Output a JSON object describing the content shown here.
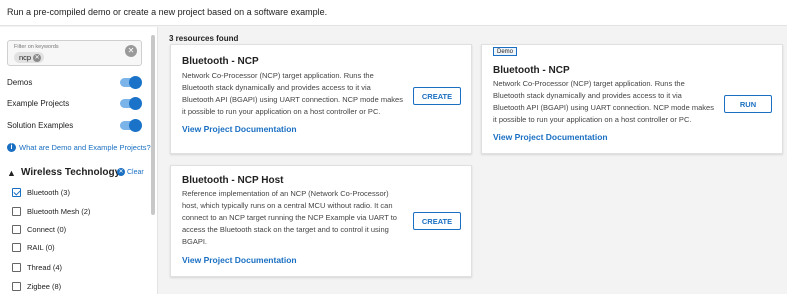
{
  "header": {
    "text": "Run a pre-compiled demo or create a new project based on a software example."
  },
  "sidebar": {
    "filter": {
      "label": "Filter on keywords",
      "chip": "ncp",
      "chip_remove": "✕",
      "clear_icon": "✕"
    },
    "toggles": [
      {
        "label": "Demos",
        "on": true
      },
      {
        "label": "Example Projects",
        "on": true
      },
      {
        "label": "Solution Examples",
        "on": true
      }
    ],
    "info_link": {
      "icon": "i",
      "text": "What are Demo and Example Projects?"
    },
    "wireless": {
      "chevron": "▲",
      "title": "Wireless Technology",
      "clear_icon": "✕",
      "clear_label": "Clear",
      "items": [
        {
          "label": "Bluetooth (3)",
          "checked": true
        },
        {
          "label": "Bluetooth Mesh (2)",
          "checked": false
        },
        {
          "label": "Connect (0)",
          "checked": false
        },
        {
          "label": "RAIL (0)",
          "checked": false
        },
        {
          "label": "Thread (4)",
          "checked": false
        },
        {
          "label": "Zigbee (8)",
          "checked": false
        }
      ]
    }
  },
  "main": {
    "results": "3 resources found",
    "cards": [
      {
        "title": "Bluetooth - NCP",
        "desc": [
          "Network Co-Processor (NCP) target application. Runs the",
          "Bluetooth stack dynamically and provides access to it via",
          "Bluetooth API (BGAPI) using UART connection. NCP mode makes",
          "it possible to run your application on a host controller or PC."
        ],
        "link": "View Project Documentation",
        "button": "CREATE"
      },
      {
        "badge": "Demo",
        "title": "Bluetooth - NCP",
        "desc": [
          "Network Co-Processor (NCP) target application. Runs the",
          "Bluetooth stack dynamically and provides access to it via",
          "Bluetooth API (BGAPI) using UART connection. NCP mode makes",
          "it possible to run your application on a host controller or PC."
        ],
        "link": "View Project Documentation",
        "button": "RUN"
      },
      {
        "title": "Bluetooth - NCP Host",
        "desc": [
          "Reference implementation of an NCP (Network Co-Processor)",
          "host, which typically runs on a central MCU without radio. It can",
          "connect to an NCP target running the NCP Example via UART to",
          "access the Bluetooth stack on the target and to control it using",
          "BGAPI."
        ],
        "link": "View Project Documentation",
        "button": "CREATE"
      }
    ]
  },
  "colors": {
    "accent": "#1a6fc2",
    "toggle_track": "#7ab4e8"
  },
  "icons": [
    "close-icon",
    "info-icon",
    "chevron-up-icon",
    "checkbox-icon"
  ]
}
